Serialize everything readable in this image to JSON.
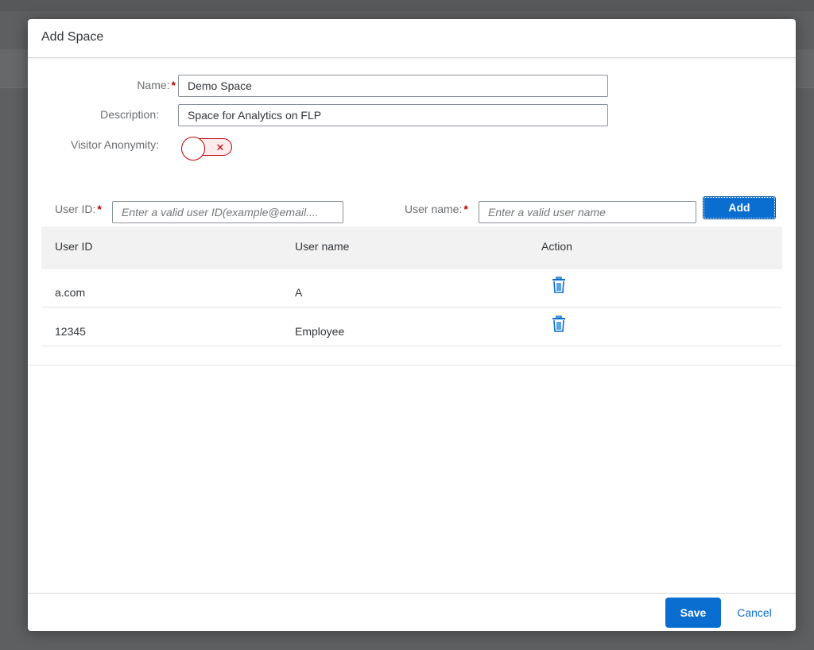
{
  "dialog": {
    "title": "Add Space"
  },
  "form": {
    "name_label": "Name:",
    "name_value": "Demo Space",
    "description_label": "Description:",
    "description_value": "Space for Analytics on FLP",
    "anonymity_label": "Visitor Anonymity:",
    "anonymity_state": "off",
    "required_mark": "*"
  },
  "add_user": {
    "user_id_label": "User ID:",
    "user_id_placeholder": "Enter a valid user ID(example@email....",
    "user_name_label": "User name:",
    "user_name_placeholder": "Enter a valid user name",
    "add_label": "Add"
  },
  "table": {
    "headers": [
      "User ID",
      "User name",
      "Action"
    ],
    "rows": [
      {
        "user_id": "a.com",
        "user_name": "A",
        "action_icon": "trash-icon"
      },
      {
        "user_id": "12345",
        "user_name": "Employee",
        "action_icon": "trash-icon"
      }
    ]
  },
  "footer": {
    "save_label": "Save",
    "cancel_label": "Cancel"
  },
  "colors": {
    "accent": "#0a6ed1",
    "required": "#bb0000",
    "switch_off": "#bb0000"
  }
}
